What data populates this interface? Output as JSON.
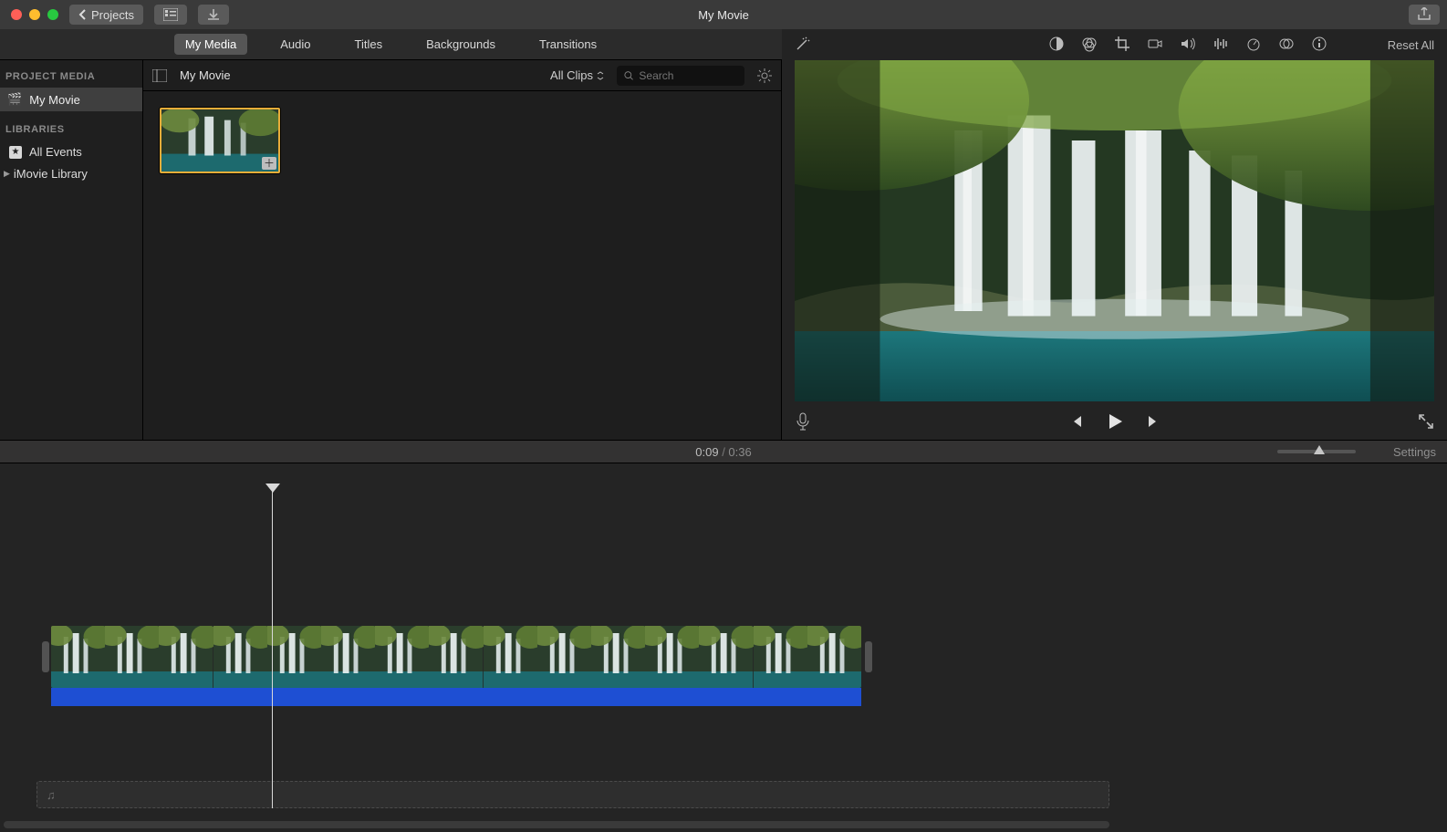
{
  "app": {
    "title": "My Movie"
  },
  "titlebar": {
    "back_label": "Projects"
  },
  "tabs": {
    "items": [
      "My Media",
      "Audio",
      "Titles",
      "Backgrounds",
      "Transitions"
    ],
    "active": 0
  },
  "sidebar": {
    "project_media_header": "PROJECT MEDIA",
    "project_name": "My Movie",
    "libraries_header": "LIBRARIES",
    "all_events": "All Events",
    "library_name": "iMovie Library"
  },
  "browser": {
    "title": "My Movie",
    "filter_label": "All Clips",
    "search_placeholder": "Search"
  },
  "viewer": {
    "reset_label": "Reset All",
    "tool_icons": [
      "enhance",
      "balance",
      "color",
      "crop",
      "stabilize",
      "volume",
      "eq",
      "noise",
      "speed",
      "info"
    ]
  },
  "playback": {
    "current_time": "0:09",
    "total_time": "0:36",
    "settings_label": "Settings"
  },
  "timeline": {
    "clip_frame_count": 15
  }
}
